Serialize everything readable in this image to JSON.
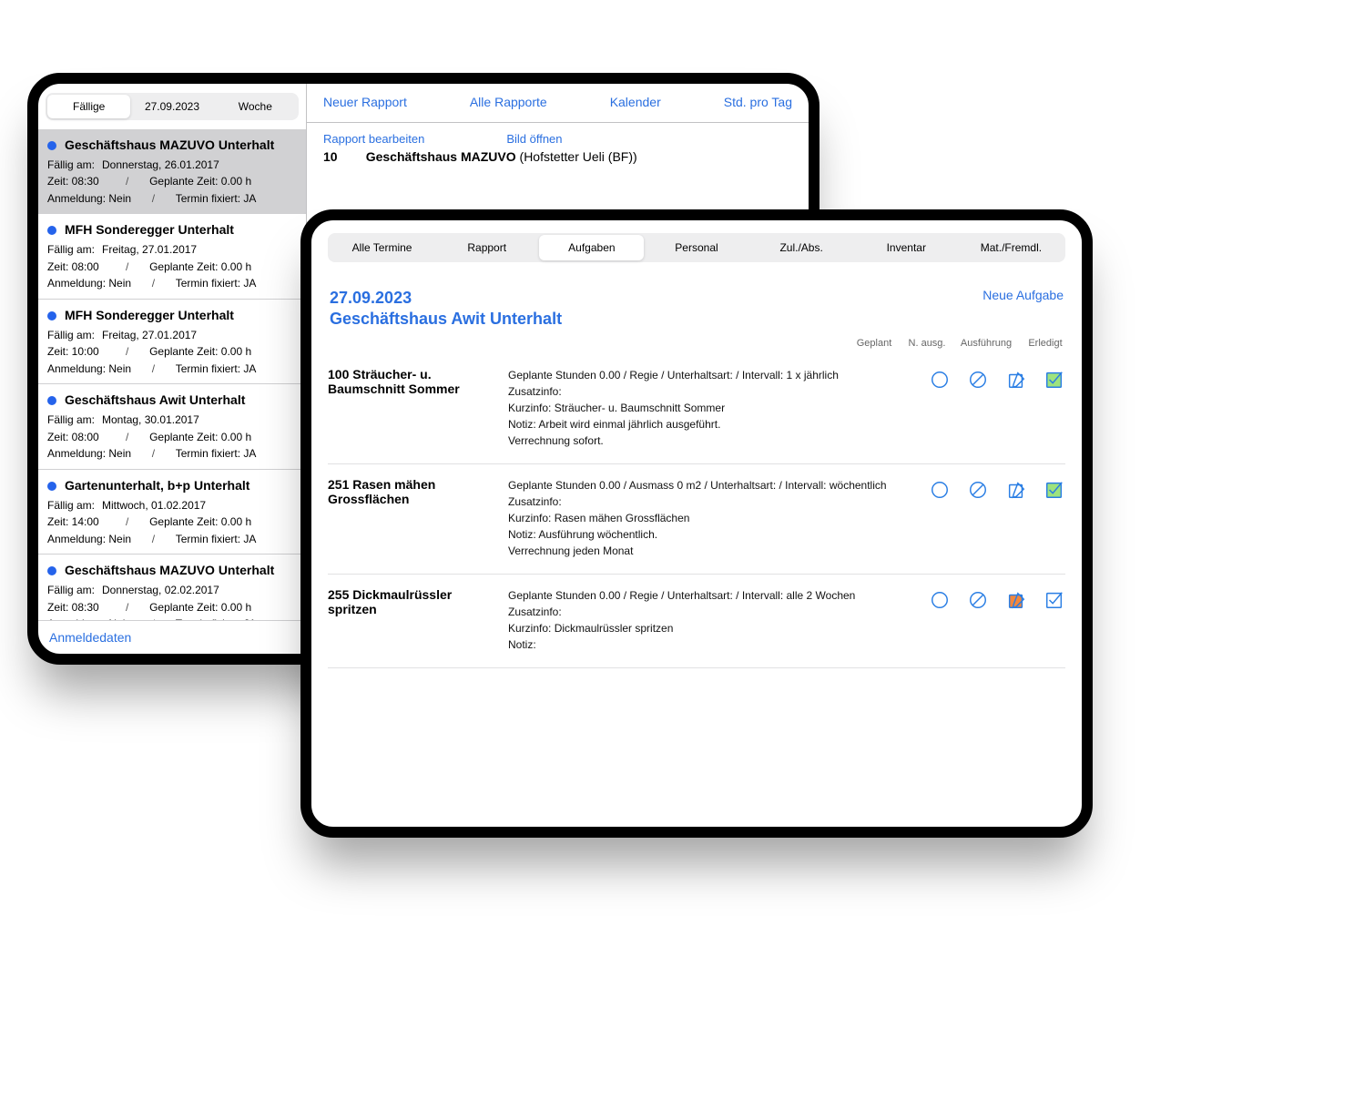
{
  "colors": {
    "link": "#2a6fe0",
    "dot": "#2563eb",
    "taskDoneFill": "#9ee37d",
    "taskInProgressFill": "#f3873c"
  },
  "back": {
    "segments": {
      "due": "Fällige",
      "date": "27.09.2023",
      "week": "Woche"
    },
    "items": [
      {
        "title": "Geschäftshaus MAZUVO Unterhalt",
        "selected": true,
        "dueLabel": "Fällig am:",
        "dueValue": "Donnerstag, 26.01.2017",
        "timeLabel": "Zeit:",
        "timeValue": "08:30",
        "plannedLabel": "Geplante Zeit:",
        "plannedValue": "0.00 h",
        "anmeldungLabel": "Anmeldung:",
        "anmeldungValue": "Nein",
        "terminLabel": "Termin fixiert:",
        "terminValue": "JA"
      },
      {
        "title": "MFH Sonderegger Unterhalt",
        "selected": false,
        "dueLabel": "Fällig am:",
        "dueValue": "Freitag, 27.01.2017",
        "timeLabel": "Zeit:",
        "timeValue": "08:00",
        "plannedLabel": "Geplante Zeit:",
        "plannedValue": "0.00 h",
        "anmeldungLabel": "Anmeldung:",
        "anmeldungValue": "Nein",
        "terminLabel": "Termin fixiert:",
        "terminValue": "JA"
      },
      {
        "title": "MFH Sonderegger Unterhalt",
        "selected": false,
        "dueLabel": "Fällig am:",
        "dueValue": "Freitag, 27.01.2017",
        "timeLabel": "Zeit:",
        "timeValue": "10:00",
        "plannedLabel": "Geplante Zeit:",
        "plannedValue": "0.00 h",
        "anmeldungLabel": "Anmeldung:",
        "anmeldungValue": "Nein",
        "terminLabel": "Termin fixiert:",
        "terminValue": "JA"
      },
      {
        "title": "Geschäftshaus Awit Unterhalt",
        "selected": false,
        "dueLabel": "Fällig am:",
        "dueValue": "Montag, 30.01.2017",
        "timeLabel": "Zeit:",
        "timeValue": "08:00",
        "plannedLabel": "Geplante Zeit:",
        "plannedValue": "0.00 h",
        "anmeldungLabel": "Anmeldung:",
        "anmeldungValue": "Nein",
        "terminLabel": "Termin fixiert:",
        "terminValue": "JA"
      },
      {
        "title": "Gartenunterhalt, b+p Unterhalt",
        "selected": false,
        "dueLabel": "Fällig am:",
        "dueValue": "Mittwoch, 01.02.2017",
        "timeLabel": "Zeit:",
        "timeValue": "14:00",
        "plannedLabel": "Geplante Zeit:",
        "plannedValue": "0.00 h",
        "anmeldungLabel": "Anmeldung:",
        "anmeldungValue": "Nein",
        "terminLabel": "Termin fixiert:",
        "terminValue": "JA"
      },
      {
        "title": "Geschäftshaus MAZUVO Unterhalt",
        "selected": false,
        "dueLabel": "Fällig am:",
        "dueValue": "Donnerstag, 02.02.2017",
        "timeLabel": "Zeit:",
        "timeValue": "08:30",
        "plannedLabel": "Geplante Zeit:",
        "plannedValue": "0.00 h",
        "anmeldungLabel": "Anmeldung:",
        "anmeldungValue": "Nein",
        "terminLabel": "Termin fixiert:",
        "terminValue": "JA"
      }
    ],
    "footerLink": "Anmeldedaten",
    "rightTop": {
      "newReport": "Neuer Rapport",
      "allReports": "Alle Rapporte",
      "calendar": "Kalender",
      "hoursPerDay": "Std. pro Tag"
    },
    "rightSub": {
      "editReport": "Rapport bearbeiten",
      "openImage": "Bild öffnen",
      "objectNum": "10",
      "objectName": "Geschäftshaus MAZUVO",
      "objectPerson": " (Hofstetter Ueli (BF))"
    }
  },
  "front": {
    "tabs": [
      "Alle Termine",
      "Rapport",
      "Aufgaben",
      "Personal",
      "Zul./Abs.",
      "Inventar",
      "Mat./Fremdl."
    ],
    "activeTabIndex": 2,
    "headerDate": "27.09.2023",
    "headerObject": "Geschäftshaus Awit Unterhalt",
    "newTaskLabel": "Neue Aufgabe",
    "columns": {
      "geplant": "Geplant",
      "nausg": "N. ausg.",
      "ausfuehrung": "Ausführung",
      "erledigt": "Erledigt"
    },
    "tasks": [
      {
        "name": "100 Sträucher- u. Baumschnitt Sommer",
        "line1": "Geplante Stunden 0.00 / Regie / Unterhaltsart:  / Intervall: 1 x jährlich",
        "line2": "Zusatzinfo:",
        "line3": "Kurzinfo: Sträucher- u. Baumschnitt Sommer",
        "line4": "Notiz: Arbeit wird einmal jährlich ausgeführt.",
        "line5": "Verrechnung sofort.",
        "status": {
          "geplant": "empty",
          "nausg": "no",
          "ausfuehrung": "edit",
          "erledigt": "done"
        }
      },
      {
        "name": "251 Rasen mähen Grossflächen",
        "line1": "Geplante Stunden 0.00 / Ausmass 0 m2 / Unterhaltsart:  / Intervall: wöchentlich",
        "line2": "Zusatzinfo:",
        "line3": "Kurzinfo: Rasen mähen Grossflächen",
        "line4": "Notiz: Ausführung wöchentlich.",
        "line5": "Verrechnung jeden Monat",
        "status": {
          "geplant": "empty",
          "nausg": "no",
          "ausfuehrung": "edit",
          "erledigt": "done"
        }
      },
      {
        "name": "255 Dickmaulrüssler spritzen",
        "line1": "Geplante Stunden 0.00 / Regie / Unterhaltsart:  / Intervall: alle 2 Wochen",
        "line2": "Zusatzinfo:",
        "line3": "Kurzinfo: Dickmaulrüssler spritzen",
        "line4": "Notiz:",
        "line5": "",
        "status": {
          "geplant": "empty",
          "nausg": "no",
          "ausfuehrung": "edit-orange",
          "erledigt": "check-outline"
        }
      }
    ]
  }
}
